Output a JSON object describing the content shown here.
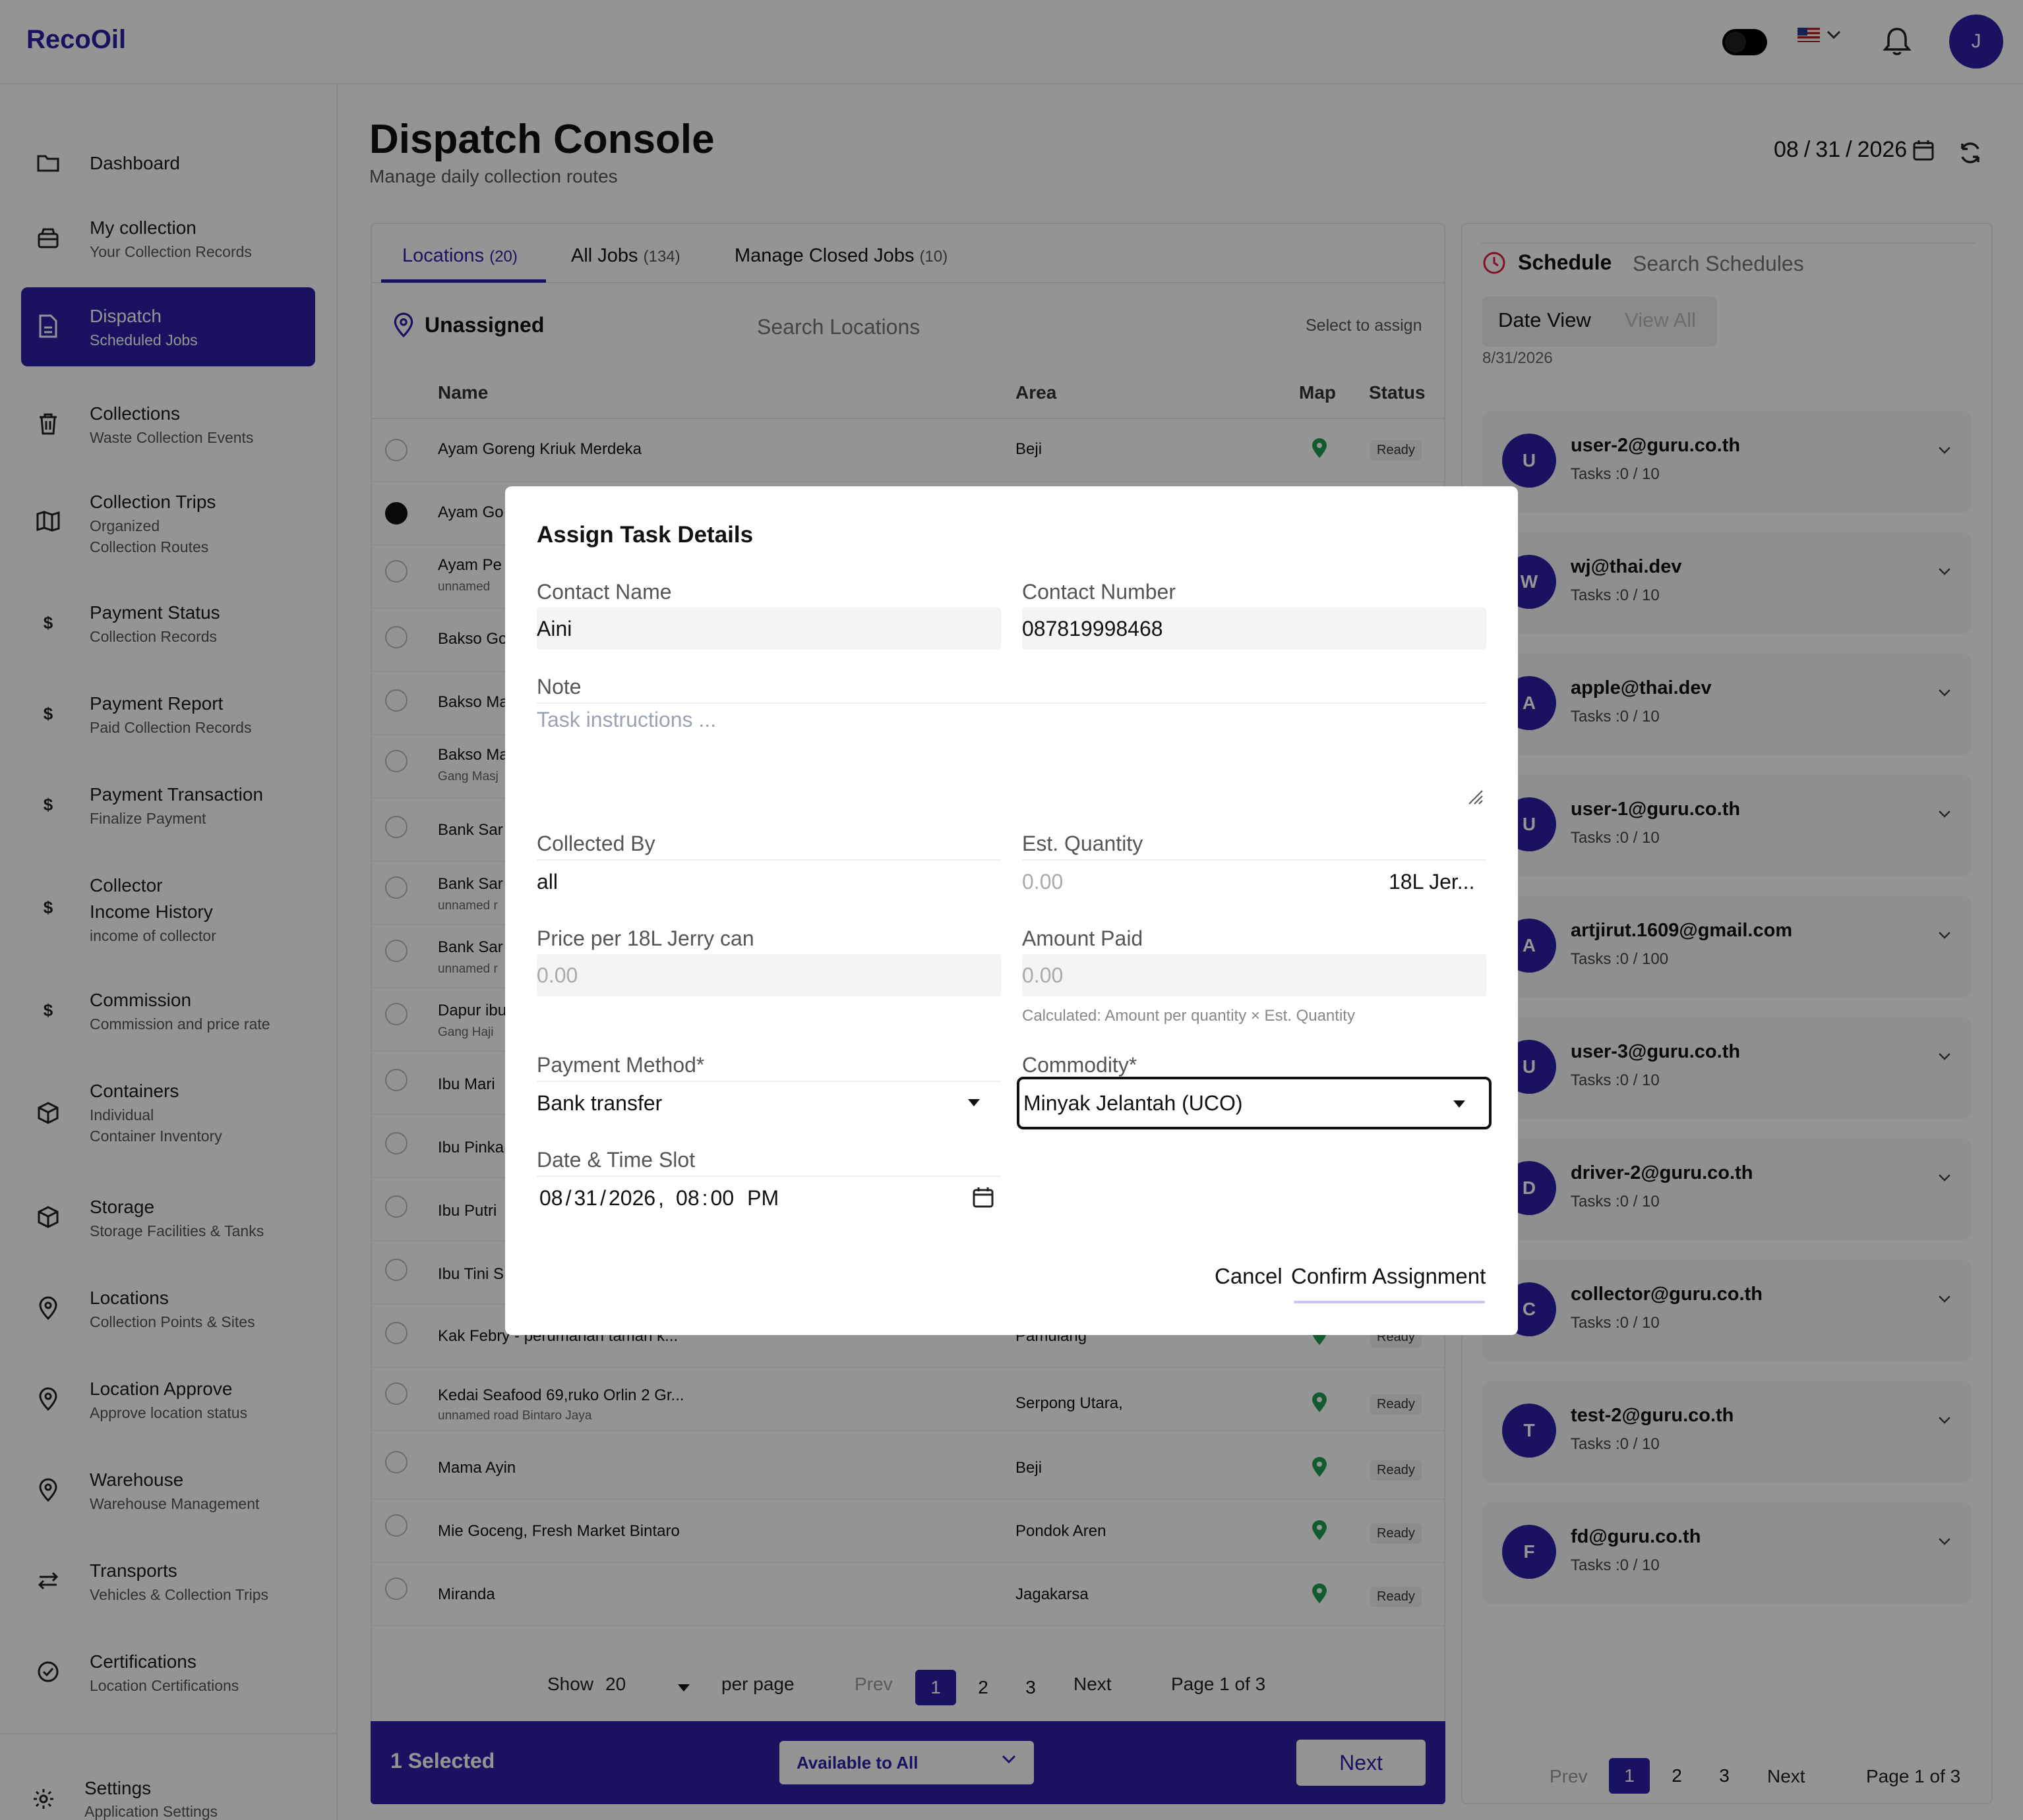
{
  "app": {
    "logo": "RecoOil",
    "avatar_initial": "J"
  },
  "sidebar": {
    "items": [
      {
        "label": "Dashboard",
        "sub": "",
        "icon": "folder-icon"
      },
      {
        "label": "My collection",
        "sub": "Your Collection Records",
        "icon": "box-icon"
      },
      {
        "label": "Dispatch",
        "sub": "Scheduled Jobs",
        "icon": "document-icon",
        "active": true
      },
      {
        "label": "Collections",
        "sub": "Waste Collection Events",
        "icon": "trash-icon"
      },
      {
        "label": "Collection Trips",
        "sub": "Organized",
        "sub2": "Collection Routes",
        "icon": "map-icon"
      },
      {
        "label": "Payment Status",
        "sub": "Collection Records",
        "icon": "dollar-icon"
      },
      {
        "label": "Payment Report",
        "sub": "Paid Collection Records",
        "icon": "dollar-icon"
      },
      {
        "label": "Payment Transaction",
        "sub": "Finalize Payment",
        "icon": "dollar-icon"
      },
      {
        "label": "Collector",
        "label2": "Income History",
        "sub": "income of collector",
        "icon": "dollar-icon"
      },
      {
        "label": "Commission",
        "sub": "Commission and price rate",
        "icon": "dollar-icon"
      },
      {
        "label": "Containers",
        "sub": "Individual",
        "sub2": "Container Inventory",
        "icon": "cube-icon"
      },
      {
        "label": "Storage",
        "sub": "Storage Facilities & Tanks",
        "icon": "cube-icon"
      },
      {
        "label": "Locations",
        "sub": "Collection Points & Sites",
        "icon": "location-pin-icon"
      },
      {
        "label": "Location Approve",
        "sub": "Approve location status",
        "icon": "location-pin-icon"
      },
      {
        "label": "Warehouse",
        "sub": "Warehouse Management",
        "icon": "location-pin-icon"
      },
      {
        "label": "Transports",
        "sub": "Vehicles & Collection Trips",
        "icon": "arrows-icon"
      },
      {
        "label": "Certifications",
        "sub": "Location Certifications",
        "icon": "check-circle-icon"
      }
    ],
    "settings": {
      "label": "Settings",
      "sub": "Application Settings"
    },
    "dollar_glyph": "$"
  },
  "header": {
    "title": "Dispatch Console",
    "subtitle": "Manage daily collection routes",
    "date": {
      "mm": "08",
      "dd": "31",
      "yyyy": "2026",
      "sep": "/"
    }
  },
  "tabs": [
    {
      "label": "Locations",
      "count": "(20)"
    },
    {
      "label": "All Jobs",
      "count": "(134)"
    },
    {
      "label": "Manage Closed Jobs",
      "count": "(10)"
    }
  ],
  "locations": {
    "heading": "Unassigned",
    "search_placeholder": "Search Locations",
    "hint": "Select to assign",
    "columns": {
      "name": "Name",
      "area": "Area",
      "map": "Map",
      "status": "Status"
    },
    "rows": [
      {
        "name": "Ayam Goreng Kriuk Merdeka",
        "addr": "",
        "area": "Beji",
        "status": "Ready"
      },
      {
        "name": "Ayam Go",
        "addr": "",
        "area": "",
        "status": ""
      },
      {
        "name": "Ayam Pe",
        "addr": "unnamed",
        "area": "",
        "status": ""
      },
      {
        "name": "Bakso Go",
        "addr": "",
        "area": "",
        "status": ""
      },
      {
        "name": "Bakso Ma",
        "addr": "",
        "area": "",
        "status": ""
      },
      {
        "name": "Bakso Ma",
        "addr": "Gang Masj",
        "area": "",
        "status": ""
      },
      {
        "name": "Bank Sar",
        "addr": "",
        "area": "",
        "status": ""
      },
      {
        "name": "Bank Sar",
        "addr": "unnamed r",
        "area": "",
        "status": ""
      },
      {
        "name": "Bank Sar",
        "addr": "unnamed r",
        "area": "",
        "status": ""
      },
      {
        "name": "Dapur ibu",
        "addr": "Gang Haji",
        "area": "",
        "status": ""
      },
      {
        "name": "Ibu Mari",
        "addr": "",
        "area": "",
        "status": ""
      },
      {
        "name": "Ibu Pinka",
        "addr": "",
        "area": "",
        "status": ""
      },
      {
        "name": "Ibu Putri",
        "addr": "",
        "area": "",
        "status": ""
      },
      {
        "name": "Ibu Tini S",
        "addr": "",
        "area": "",
        "status": ""
      },
      {
        "name": "Kak Febry - perumahan taman k...",
        "addr": "",
        "area": "Pamulang",
        "status": "Ready"
      },
      {
        "name": "Kedai Seafood 69,ruko Orlin 2 Gr...",
        "addr": "unnamed road Bintaro Jaya",
        "area": "Serpong Utara,",
        "status": "Ready"
      },
      {
        "name": "Mama Ayin",
        "addr": "",
        "area": "Beji",
        "status": "Ready"
      },
      {
        "name": "Mie Goceng, Fresh Market Bintaro",
        "addr": "",
        "area": "Pondok Aren",
        "status": "Ready"
      },
      {
        "name": "Miranda",
        "addr": "",
        "area": "Jagakarsa",
        "status": "Ready"
      }
    ],
    "pager": {
      "show": "Show",
      "per_page_value": "20",
      "per_page": "per page",
      "prev": "Prev",
      "pages": [
        "1",
        "2",
        "3"
      ],
      "next": "Next",
      "info": "Page 1 of 3"
    },
    "footer": {
      "selected": "1 Selected",
      "dropdown": "Available to All",
      "next": "Next"
    }
  },
  "schedule": {
    "title": "Schedule",
    "search_placeholder": "Search Schedules",
    "date_view": "Date View",
    "view_all": "View All",
    "date": "8/31/2026",
    "users": [
      {
        "initial": "U",
        "email": "user-2@guru.co.th",
        "tasks": "Tasks :0 / 10"
      },
      {
        "initial": "W",
        "email": "wj@thai.dev",
        "tasks": "Tasks :0 / 10"
      },
      {
        "initial": "A",
        "email": "apple@thai.dev",
        "tasks": "Tasks :0 / 10"
      },
      {
        "initial": "U",
        "email": "user-1@guru.co.th",
        "tasks": "Tasks :0 / 10"
      },
      {
        "initial": "A",
        "email": "artjirut.1609@gmail.com",
        "tasks": "Tasks :0 / 100"
      },
      {
        "initial": "U",
        "email": "user-3@guru.co.th",
        "tasks": "Tasks :0 / 10"
      },
      {
        "initial": "D",
        "email": "driver-2@guru.co.th",
        "tasks": "Tasks :0 / 10"
      },
      {
        "initial": "C",
        "email": "collector@guru.co.th",
        "tasks": "Tasks :0 / 10"
      },
      {
        "initial": "T",
        "email": "test-2@guru.co.th",
        "tasks": "Tasks :0 / 10"
      },
      {
        "initial": "F",
        "email": "fd@guru.co.th",
        "tasks": "Tasks :0 / 10"
      }
    ],
    "pager": {
      "prev": "Prev",
      "pages": [
        "1",
        "2",
        "3"
      ],
      "next": "Next",
      "info": "Page 1 of 3"
    }
  },
  "modal": {
    "title": "Assign Task Details",
    "contact_name_label": "Contact Name",
    "contact_name": "Aini",
    "contact_number_label": "Contact Number",
    "contact_number": "087819998468",
    "note_label": "Note",
    "note_placeholder": "Task instructions ...",
    "collected_by_label": "Collected By",
    "collected_by": "all",
    "est_qty_label": "Est. Quantity",
    "est_qty_placeholder": "0.00",
    "unit": "18L Jer...",
    "price_label": "Price per 18L Jerry can",
    "price_placeholder": "0.00",
    "amount_label": "Amount Paid",
    "amount_placeholder": "0.00",
    "amount_hint": "Calculated: Amount per quantity × Est. Quantity",
    "payment_label": "Payment Method*",
    "payment_value": "Bank transfer",
    "commodity_label": "Commodity*",
    "commodity_value": "Minyak Jelantah (UCO)",
    "datetime_label": "Date & Time Slot",
    "datetime": {
      "mm": "08",
      "dd": "31",
      "yyyy": "2026",
      "hh": "08",
      "min": "00",
      "ampm": "PM",
      "sep": "/",
      "comma": ",",
      "colon": ":"
    },
    "cancel": "Cancel",
    "confirm": "Confirm Assignment"
  },
  "colors": {
    "brand": "#2a1fa6",
    "ready_pin": "#1f9d55",
    "overlay": "rgba(0,0,0,0.42)"
  }
}
